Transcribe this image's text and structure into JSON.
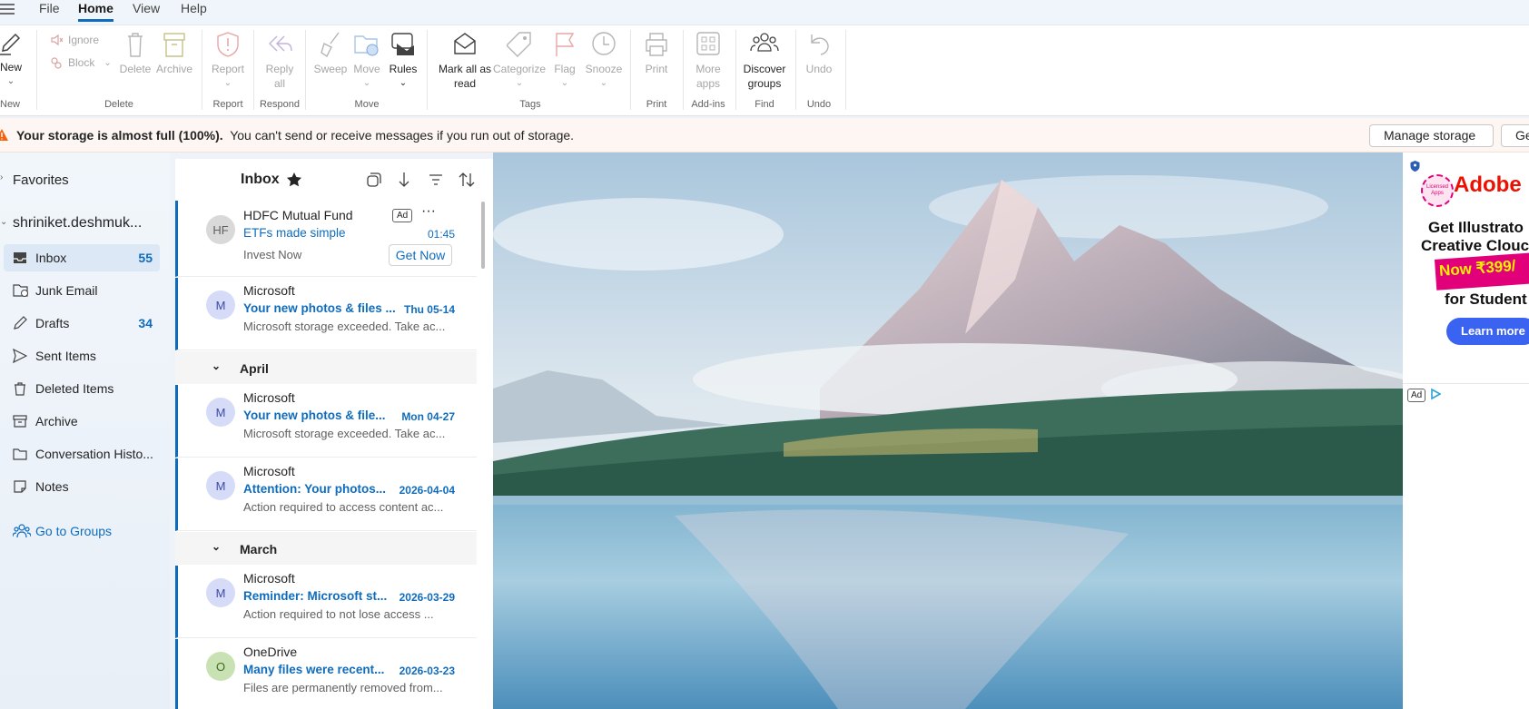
{
  "menubar": {
    "items": [
      {
        "label": "File",
        "active": false
      },
      {
        "label": "Home",
        "active": true
      },
      {
        "label": "View",
        "active": false
      },
      {
        "label": "Help",
        "active": false
      }
    ]
  },
  "ribbon": {
    "new": {
      "label": "New",
      "group": "New"
    },
    "ignore": "Ignore",
    "block": "Block",
    "delete": "Delete",
    "archive": "Archive",
    "delete_group": "Delete",
    "report": "Report",
    "report_group": "Report",
    "reply_all_line1": "Reply",
    "reply_all_line2": "all",
    "respond_group": "Respond",
    "sweep": "Sweep",
    "move": "Move",
    "rules": "Rules",
    "move_group": "Move",
    "mark_all_read_line1": "Mark all as",
    "mark_all_read_line2": "read",
    "categorize": "Categorize",
    "flag": "Flag",
    "snooze": "Snooze",
    "tags_group": "Tags",
    "print": "Print",
    "print_group": "Print",
    "more_apps_line1": "More",
    "more_apps_line2": "apps",
    "addins_group": "Add-ins",
    "discover_groups_line1": "Discover",
    "discover_groups_line2": "groups",
    "find_group": "Find",
    "undo": "Undo",
    "undo_group": "Undo"
  },
  "banner": {
    "bold_text": "Your storage is almost full (100%).",
    "text": "You can't send or receive messages if you run out of storage.",
    "manage_button": "Manage storage",
    "get_button": "Ge"
  },
  "nav": {
    "favorites": "Favorites",
    "account": "shriniket.deshmuk...",
    "folders": [
      {
        "label": "Inbox",
        "count": "55",
        "icon": "inbox-icon",
        "selected": true
      },
      {
        "label": "Junk Email",
        "count": "",
        "icon": "junk-icon",
        "selected": false
      },
      {
        "label": "Drafts",
        "count": "34",
        "icon": "drafts-icon",
        "selected": false
      },
      {
        "label": "Sent Items",
        "count": "",
        "icon": "sent-icon",
        "selected": false
      },
      {
        "label": "Deleted Items",
        "count": "",
        "icon": "trash-icon",
        "selected": false
      },
      {
        "label": "Archive",
        "count": "",
        "icon": "archive-icon",
        "selected": false
      },
      {
        "label": "Conversation Histo...",
        "count": "",
        "icon": "folder-icon",
        "selected": false
      },
      {
        "label": "Notes",
        "count": "",
        "icon": "notes-icon",
        "selected": false
      }
    ],
    "go_to_groups": "Go to Groups"
  },
  "list": {
    "title": "Inbox",
    "ad_message": {
      "initials": "HF",
      "sender": "HDFC Mutual Fund",
      "ad_badge": "Ad",
      "subject": "ETFs made simple",
      "time": "01:45",
      "preview": "Invest Now",
      "cta": "Get Now"
    },
    "messages": [
      {
        "initials": "M",
        "sender": "Microsoft",
        "subject": "Your new photos & files ...",
        "date": "Thu 05-14",
        "preview": "Microsoft storage exceeded. Take ac..."
      },
      {
        "section": "April"
      },
      {
        "initials": "M",
        "sender": "Microsoft",
        "subject": "Your new photos & file...",
        "date": "Mon 04-27",
        "preview": "Microsoft storage exceeded. Take ac..."
      },
      {
        "initials": "M",
        "sender": "Microsoft",
        "subject": "Attention: Your photos...",
        "date": "2026-04-04",
        "preview": "Action required to access content ac..."
      },
      {
        "section": "March"
      },
      {
        "initials": "M",
        "sender": "Microsoft",
        "subject": "Reminder: Microsoft st...",
        "date": "2026-03-29",
        "preview": "Action required to not lose access    ..."
      },
      {
        "initials": "O",
        "sender": "OneDrive",
        "subject": "Many files were recent...",
        "date": "2026-03-23",
        "preview": "Files are permanently removed from..."
      }
    ]
  },
  "ad_panel": {
    "brand": "Adobe",
    "seal_text": "Licensed Apps",
    "line1": "Get Illustrato",
    "line2": "Creative Clouc",
    "price": "Now ₹399/",
    "line3": "for Student",
    "cta": "Learn more",
    "ad_label": "Ad"
  },
  "colors": {
    "accent": "#0f6cbd",
    "banner_bg": "#fdf6f2",
    "nav_selected": "#dce8f6",
    "adobe_red": "#eb1000",
    "ad_button": "#3b63f2"
  }
}
